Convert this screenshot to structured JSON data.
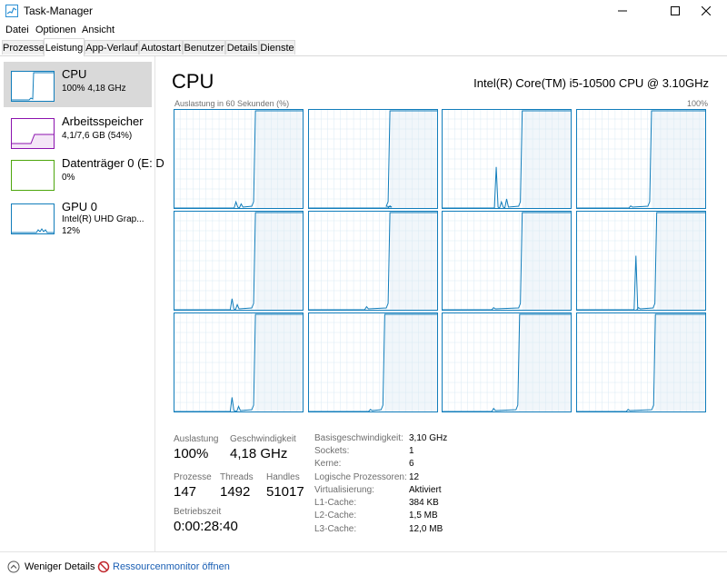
{
  "window": {
    "title": "Task-Manager"
  },
  "menu": [
    "Datei",
    "Optionen",
    "Ansicht"
  ],
  "tabs": [
    "Prozesse",
    "Leistung",
    "App-Verlauf",
    "Autostart",
    "Benutzer",
    "Details",
    "Dienste"
  ],
  "active_tab": "Leistung",
  "sidebar": [
    {
      "name": "CPU",
      "sub1": "100% 4,18 GHz",
      "sub2": "",
      "color": "#117dbb",
      "selected": true
    },
    {
      "name": "Arbeitsspeicher",
      "sub1": "4,1/7,6 GB (54%)",
      "sub2": "",
      "color": "#8b12ae",
      "selected": false
    },
    {
      "name": "Datenträger 0 (E: D",
      "sub1": "0%",
      "sub2": "",
      "color": "#4da60c",
      "selected": false
    },
    {
      "name": "GPU 0",
      "sub1": "Intel(R) UHD Grap...",
      "sub2": "12%",
      "color": "#117dbb",
      "selected": false
    }
  ],
  "main": {
    "title": "CPU",
    "model": "Intel(R) Core(TM) i5-10500 CPU @ 3.10GHz",
    "util_label": "Auslastung in 60 Sekunden (%)",
    "max_label": "100%"
  },
  "stats": {
    "auslastung_label": "Auslastung",
    "auslastung_value": "100%",
    "geschwindigkeit_label": "Geschwindigkeit",
    "geschwindigkeit_value": "4,18 GHz",
    "prozesse_label": "Prozesse",
    "prozesse_value": "147",
    "threads_label": "Threads",
    "threads_value": "1492",
    "handles_label": "Handles",
    "handles_value": "51017",
    "betriebszeit_label": "Betriebszeit",
    "betriebszeit_value": "0:00:28:40"
  },
  "info": [
    {
      "key": "Basisgeschwindigkeit:",
      "value": "3,10 GHz"
    },
    {
      "key": "Sockets:",
      "value": "1"
    },
    {
      "key": "Kerne:",
      "value": "6"
    },
    {
      "key": "Logische Prozessoren:",
      "value": "12"
    },
    {
      "key": "Virtualisierung:",
      "value": "Aktiviert"
    },
    {
      "key": "L1-Cache:",
      "value": "384 KB"
    },
    {
      "key": "L2-Cache:",
      "value": "1,5 MB"
    },
    {
      "key": "L3-Cache:",
      "value": "12,0 MB"
    }
  ],
  "footer": {
    "fewer_details": "Weniger Details",
    "resource_monitor": "Ressourcenmonitor öffnen"
  },
  "colors": {
    "cpu_line": "#117dbb",
    "cpu_fill": "#f1f6fa",
    "grid": "#d9eaf4",
    "selection": "#d9d9d9"
  }
}
